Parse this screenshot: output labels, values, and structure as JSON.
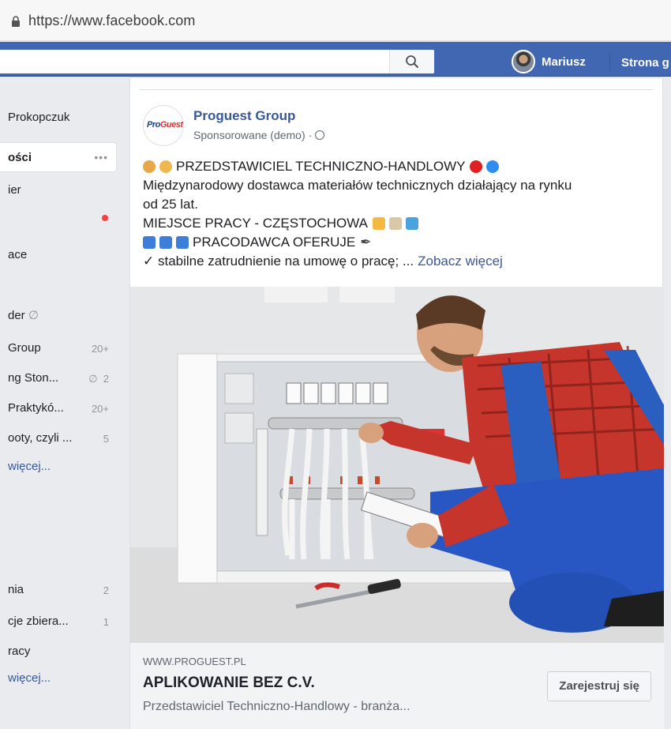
{
  "browser": {
    "url": "https://www.facebook.com"
  },
  "topbar": {
    "search_placeholder": "",
    "user_name": "Mariusz",
    "home_label": "Strona g"
  },
  "sidebar": {
    "items": [
      {
        "label": "Prokopczuk",
        "count": ""
      },
      {
        "label": "ości",
        "count": "•••"
      },
      {
        "label": "ier",
        "count": ""
      },
      {
        "label": "",
        "count": ""
      },
      {
        "label": "ace",
        "count": ""
      },
      {
        "label": "der",
        "count": ""
      },
      {
        "label": "Group",
        "count": "20+"
      },
      {
        "label": "ng Ston...",
        "count": "2"
      },
      {
        "label": "Praktykó...",
        "count": "20+"
      },
      {
        "label": "ooty, czyli ...",
        "count": "5"
      },
      {
        "label": "więcej...",
        "count": ""
      },
      {
        "label": "nia",
        "count": "2"
      },
      {
        "label": "cje zbiera...",
        "count": "1"
      },
      {
        "label": "racy",
        "count": ""
      },
      {
        "label": "więcej...",
        "count": ""
      }
    ]
  },
  "post": {
    "page_name": "Proguest Group",
    "sponsored": "Sponsorowane (demo) ·",
    "logo_text_a": "Pro",
    "logo_text_b": "Guest",
    "lines": [
      "PRZEDSTAWICIEL TECHNICZNO-HANDLOWY",
      "Międzynarodowy dostawca materiałów technicznych działający na rynku",
      "od 25 lat.",
      "MIEJSCE PRACY - CZĘSTOCHOWA",
      "PRACODAWCA OFERUJE",
      "✓ stabilne zatrudnienie na umowę o pracę; ..."
    ],
    "see_more": "Zobacz więcej"
  },
  "link": {
    "domain": "WWW.PROGUEST.PL",
    "headline": "APLIKOWANIE BEZ C.V.",
    "description": "Przedstawiciel Techniczno-Handlowy - branża...",
    "cta": "Zarejestruj się"
  },
  "colors": {
    "fb_blue": "#4267b2",
    "link": "#385898",
    "notification": "#fa3e3e"
  }
}
